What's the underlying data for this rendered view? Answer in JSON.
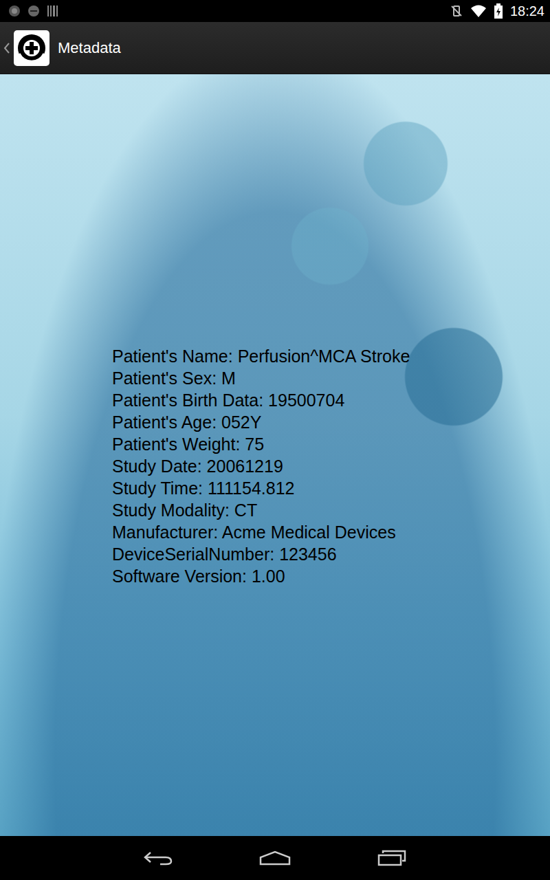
{
  "status_bar": {
    "time": "18:24"
  },
  "action_bar": {
    "title": "Metadata"
  },
  "metadata": {
    "lines": [
      "Patient's Name: Perfusion^MCA Stroke",
      "Patient's Sex: M",
      "Patient's Birth Data: 19500704",
      "Patient's Age: 052Y",
      "Patient's Weight: 75",
      "Study Date: 20061219",
      "Study Time: 111154.812",
      "Study Modality: CT",
      "Manufacturer: Acme Medical Devices",
      "DeviceSerialNumber: 123456",
      "Software Version: 1.00"
    ]
  }
}
